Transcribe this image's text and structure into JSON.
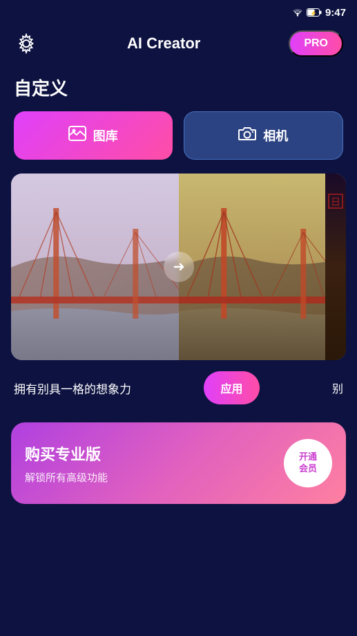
{
  "statusBar": {
    "time": "9:47"
  },
  "header": {
    "title": "AI Creator",
    "proBadge": "PRO"
  },
  "section": {
    "title": "自定义"
  },
  "buttons": {
    "gallery": "图库",
    "camera": "相机"
  },
  "slider": {
    "arrow": "→"
  },
  "bottomRow": {
    "text": "拥有别具一格的想象力",
    "applyBtn": "应用",
    "moreText": "别"
  },
  "proCard": {
    "title": "购买专业版",
    "subtitle": "解锁所有高级功能",
    "btnLine1": "开通",
    "btnLine2": "会员"
  },
  "icons": {
    "gear": "⚙",
    "gallery": "🖼",
    "camera": "📷"
  }
}
